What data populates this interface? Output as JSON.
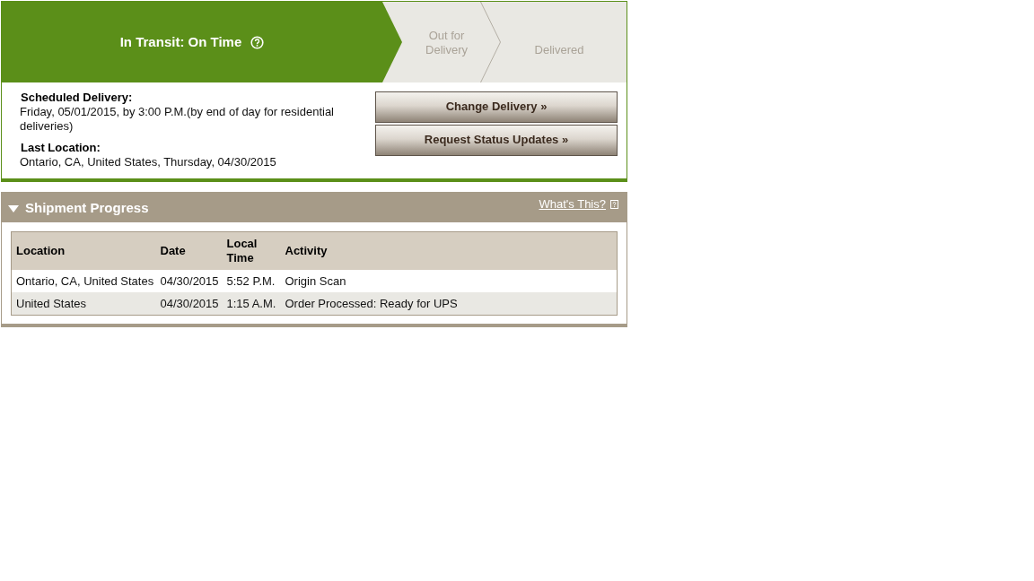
{
  "progress": {
    "steps": [
      {
        "label": "In Transit: On Time",
        "selected": true,
        "help": true
      },
      {
        "label": "Out for Delivery",
        "selected": false,
        "help": false
      },
      {
        "label": "Delivered",
        "selected": false,
        "help": false
      }
    ]
  },
  "delivery": {
    "fields": [
      {
        "label": "Scheduled Delivery:",
        "value": "Friday, 05/01/2015, by 3:00 P.M.(by end of day for residential deliveries)"
      },
      {
        "label": "Last Location:",
        "value": "Ontario, CA, United States, Thursday, 04/30/2015"
      }
    ],
    "buttons": [
      "Change Delivery »",
      "Request Status Updates »"
    ]
  },
  "shipment_progress": {
    "title": "Shipment Progress",
    "expanded": true,
    "help_link": "What's This?",
    "table": {
      "columns": [
        "Location",
        "Date",
        "Local Time",
        "Activity"
      ],
      "rows": [
        [
          "Ontario, CA, United States",
          "04/30/2015",
          "5:52 P.M.",
          "Origin Scan"
        ],
        [
          "United States",
          "04/30/2015",
          "1:15 A.M.",
          "Order Processed: Ready for UPS"
        ]
      ]
    }
  }
}
